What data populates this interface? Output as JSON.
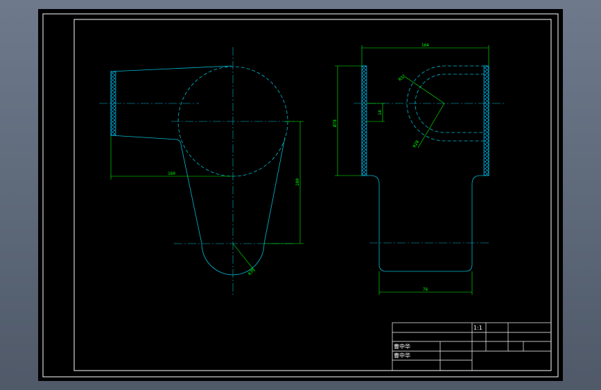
{
  "colors": {
    "background": "#000000",
    "frame": "#ffffff",
    "outline": "#00bcd4",
    "dimension": "#00ff00",
    "hatch": "#00c8ff"
  },
  "front_view": {
    "dim_width": "160",
    "dim_height": "180",
    "dim_radius": "R36"
  },
  "side_view": {
    "dim_top_width": "164",
    "dim_height": "Ø78",
    "dim_small": "14",
    "dim_radius_outer": "R32",
    "dim_radius_inner": "R28",
    "dim_bottom_width": "76"
  },
  "title_block": {
    "scale": "1:1",
    "name_row1": "曹中华",
    "name_row2": "曹中华"
  }
}
